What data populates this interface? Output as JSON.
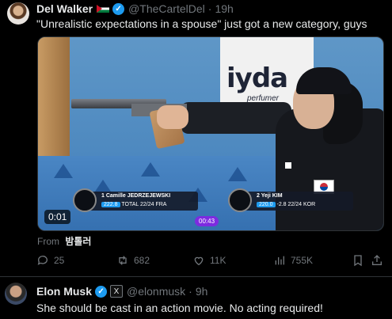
{
  "tweet1": {
    "author_name": "Del Walker",
    "handle": "@TheCartelDel",
    "time": "19h",
    "text": "\"Unrealistic expectations in a spouse\" just got a new category, guys",
    "media": {
      "banner_text": "iyda",
      "banner_sub": "perfumer",
      "video_time": "0:01",
      "timer": "00:43",
      "shooter1": {
        "rank": "1",
        "name": "Camille JEDRZEJEWSKI",
        "score": "222.8",
        "total_label": "TOTAL",
        "shots": "22/24",
        "nation": "FRA"
      },
      "shooter2": {
        "rank": "2",
        "name": "Yeji KIM",
        "score": "220.0",
        "diff": "-2.8",
        "shots": "22/24",
        "nation": "KOR"
      }
    },
    "from_label": "From",
    "from_source": "밤톨러",
    "actions": {
      "replies": "25",
      "retweets": "682",
      "likes": "11K",
      "views": "755K"
    }
  },
  "tweet2": {
    "author_name": "Elon Musk",
    "handle": "@elonmusk",
    "time": "9h",
    "text": "She should be cast in an action movie. No  acting required!"
  },
  "colors": {
    "background": "#000000",
    "text": "#e7e9ea",
    "muted": "#71767b",
    "verified": "#1d9bf0"
  }
}
